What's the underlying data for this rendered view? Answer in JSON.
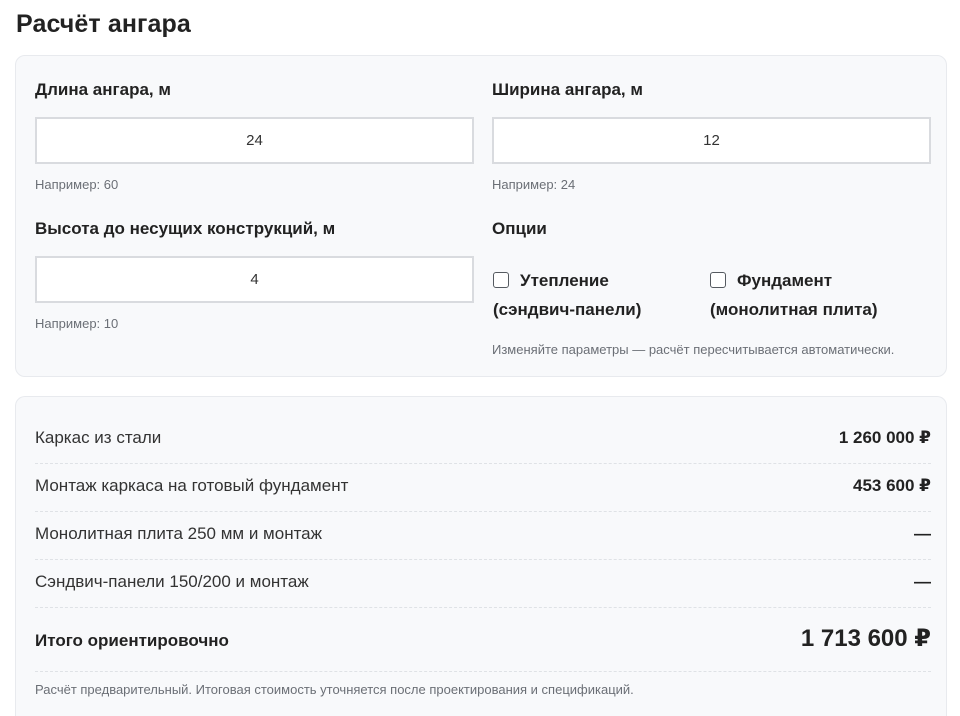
{
  "page": {
    "title": "Расчёт ангара"
  },
  "form": {
    "length": {
      "label": "Длина ангара, м",
      "value": "24",
      "hint": "Например: 60"
    },
    "width": {
      "label": "Ширина ангара, м",
      "value": "12",
      "hint": "Например: 24"
    },
    "height": {
      "label": "Высота до несущих конструкций, м",
      "value": "4",
      "hint": "Например: 10"
    },
    "options": {
      "label": "Опции",
      "insulation": {
        "line1": "Утепление",
        "line2": "(сэндвич-панели)",
        "checked": false
      },
      "foundation": {
        "line1": "Фундамент",
        "line2": "(монолитная плита)",
        "checked": false
      },
      "note": "Изменяйте параметры — расчёт пересчитывается автоматически."
    }
  },
  "results": {
    "rows": [
      {
        "label": "Каркас из стали",
        "value": "1 260 000 ₽"
      },
      {
        "label": "Монтаж каркаса на готовый фундамент",
        "value": "453 600 ₽"
      },
      {
        "label": "Монолитная плита 250 мм и монтаж",
        "value": "—"
      },
      {
        "label": "Сэндвич-панели 150/200 и монтаж",
        "value": "—"
      }
    ],
    "total": {
      "label": "Итого ориентировочно",
      "value": "1 713 600 ₽"
    },
    "disclaimer": "Расчёт предварительный. Итоговая стоимость уточняется после проектирования и спецификаций."
  }
}
